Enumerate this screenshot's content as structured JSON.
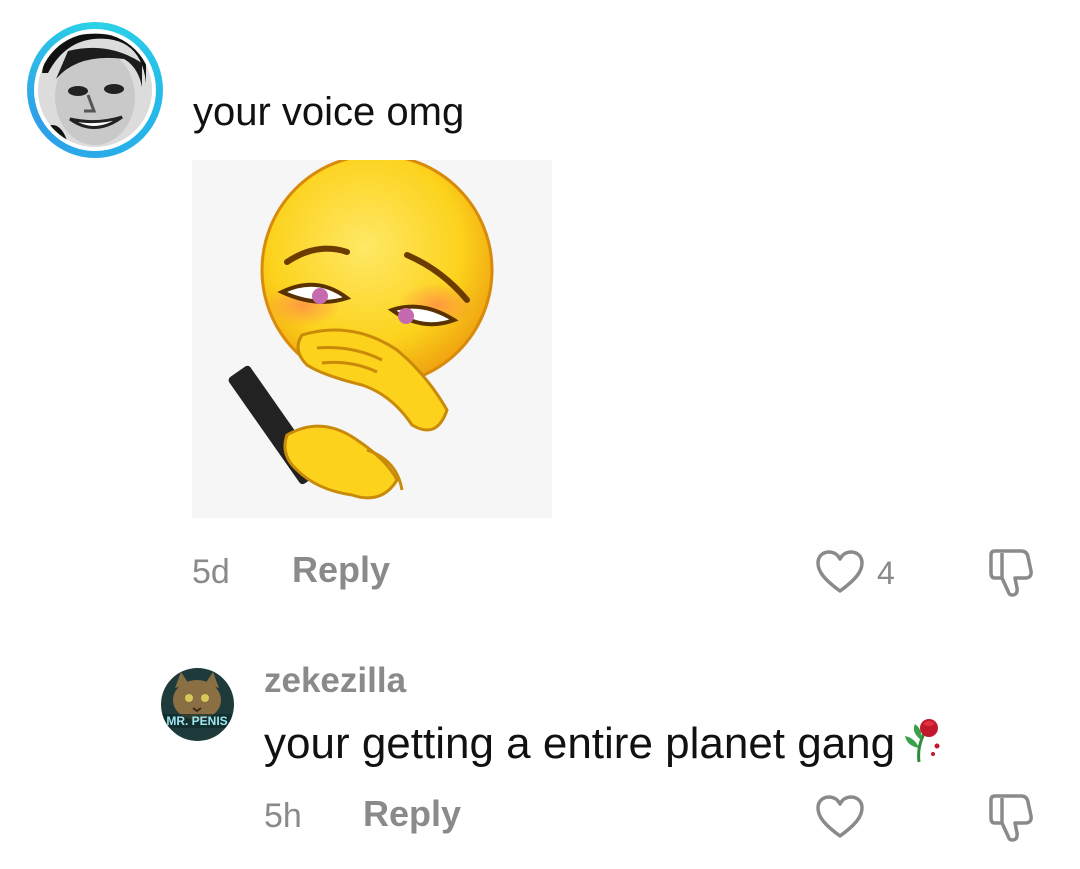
{
  "comments": [
    {
      "text": "your voice omg",
      "time": "5d",
      "reply_label": "Reply",
      "likes": "4",
      "icons": {
        "avatar": "user-avatar",
        "sticker": "shy-emoji-phone-sticker",
        "like": "heart-icon",
        "dislike": "thumbs-down-icon"
      }
    },
    {
      "username": "zekezilla",
      "text": "your getting a entire planet gang",
      "time": "5h",
      "reply_label": "Reply",
      "icons": {
        "avatar": "cat-avatar",
        "emoji": "wilted-rose-icon",
        "like": "heart-icon",
        "dislike": "thumbs-down-icon"
      }
    }
  ],
  "avatar_badge_text": "MR. PENIS",
  "colors": {
    "ring": "#2bd3e6",
    "meta": "#8a8a8a",
    "text": "#111111"
  }
}
